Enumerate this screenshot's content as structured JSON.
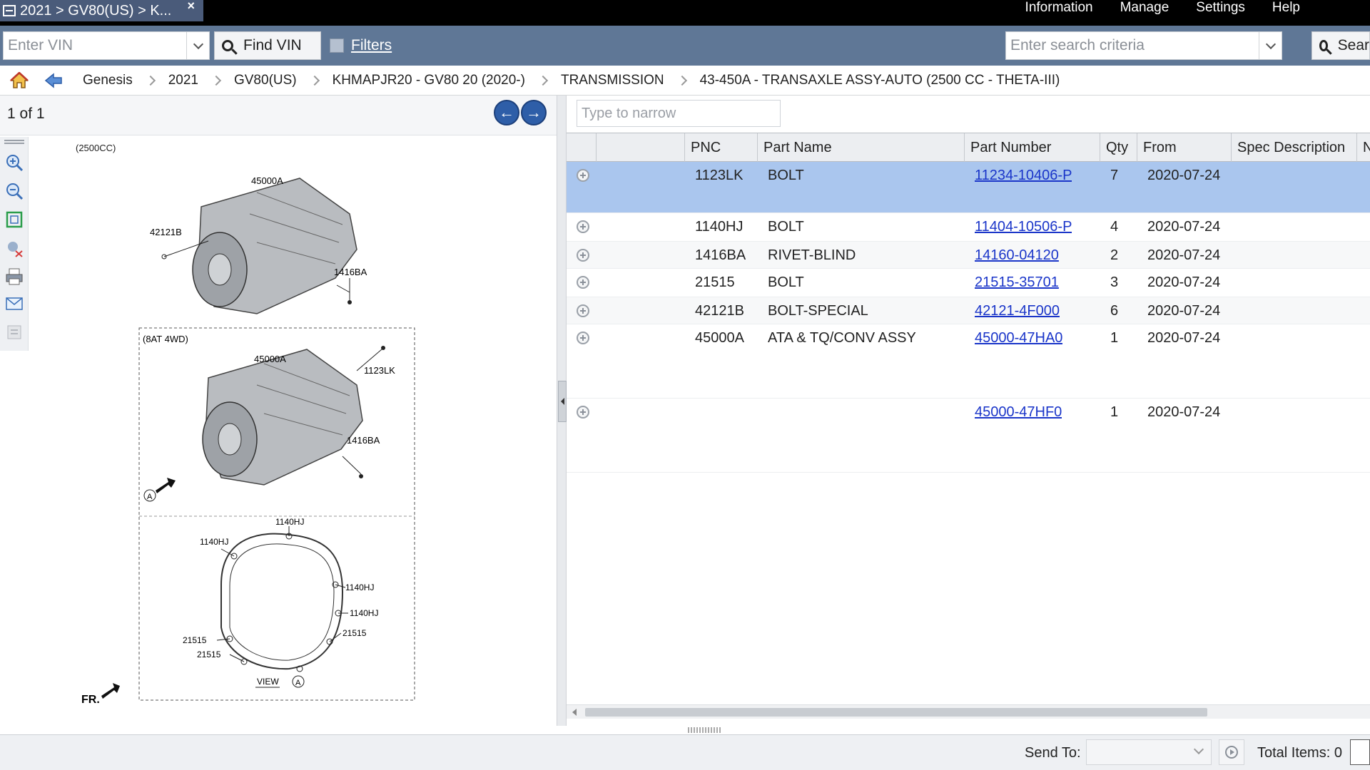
{
  "window": {
    "tab_title": "2021 > GV80(US) > K...",
    "tab_close": "×"
  },
  "menu": [
    "Information",
    "Manage",
    "Settings",
    "Help"
  ],
  "toolbar": {
    "vin_placeholder": "Enter VIN",
    "find_vin_label": "Find VIN",
    "filters_label": "Filters",
    "search_placeholder": "Enter search criteria",
    "search_label": "Sear"
  },
  "breadcrumb": [
    "Genesis",
    "2021",
    "GV80(US)",
    "KHMAPJR20 - GV80 20 (2020-)",
    "TRANSMISSION",
    "43-450A - TRANSAXLE ASSY-AUTO (2500 CC - THETA-III)"
  ],
  "pager": {
    "count": "1 of 1",
    "prev": "←",
    "next": "→"
  },
  "diagram": {
    "label_top": "(2500CC)",
    "label_box": "(8AT 4WD)",
    "callouts": {
      "a1": "45000A",
      "a2": "42121B",
      "a3": "1416BA",
      "b1": "45000A",
      "b2": "1123LK",
      "b3": "1416BA",
      "c1": "1140HJ",
      "c2": "1140HJ",
      "c3": "1140HJ",
      "c4": "1140HJ",
      "c5": "21515",
      "c6": "21515",
      "c7": "21515"
    },
    "marker_a": "A",
    "view_label": "VIEW",
    "view_marker": "A",
    "fr_label": "FR."
  },
  "narrow_placeholder": "Type to narrow",
  "columns": [
    "PNC",
    "Part Name",
    "Part Number",
    "Qty",
    "From",
    "Spec Description",
    "N"
  ],
  "rows": [
    {
      "pnc": "1123LK",
      "name": "BOLT",
      "part": "11234-10406-P",
      "qty": "7",
      "from": "2020-07-24",
      "selected": true
    },
    {
      "pnc": "1140HJ",
      "name": "BOLT",
      "part": "11404-10506-P",
      "qty": "4",
      "from": "2020-07-24"
    },
    {
      "pnc": "1416BA",
      "name": "RIVET-BLIND",
      "part": "14160-04120",
      "qty": "2",
      "from": "2020-07-24"
    },
    {
      "pnc": "21515",
      "name": "BOLT",
      "part": "21515-35701",
      "qty": "3",
      "from": "2020-07-24"
    },
    {
      "pnc": "42121B",
      "name": "BOLT-SPECIAL",
      "part": "42121-4F000",
      "qty": "6",
      "from": "2020-07-24"
    },
    {
      "pnc": "45000A",
      "name": "ATA & TQ/CONV ASSY",
      "part": "45000-47HA0",
      "qty": "1",
      "from": "2020-07-24"
    },
    {
      "pnc": "",
      "name": "",
      "part": "45000-47HF0",
      "qty": "1",
      "from": "2020-07-24"
    }
  ],
  "status": {
    "send_to_label": "Send To:",
    "total_items": "Total Items: 0"
  },
  "colors": {
    "toolbar_bg": "#5f7796",
    "selected_row": "#aac6ee",
    "link": "#1a35c9"
  }
}
